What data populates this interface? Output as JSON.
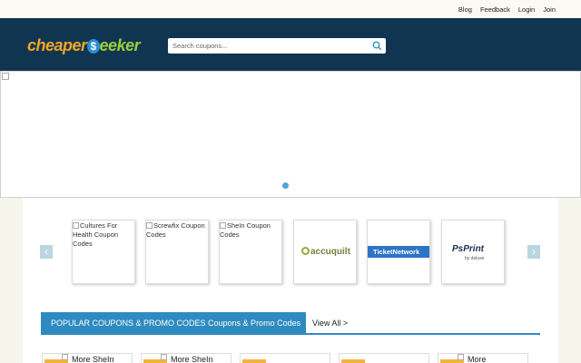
{
  "top_links": [
    "Blog",
    "Feedback",
    "Login",
    "Join"
  ],
  "logo": {
    "part1": "cheaper",
    "dollar": "$",
    "part2": "eeker"
  },
  "search": {
    "placeholder": "Search coupons..."
  },
  "stores": [
    {
      "label": "Cultures For Health Coupon Codes"
    },
    {
      "label": "Screwfix Coupon Codes"
    },
    {
      "label": "SheIn Coupon Codes"
    },
    {
      "logo": "accuquilt"
    },
    {
      "logo": "TicketNetwork"
    },
    {
      "logo": "PsPrint",
      "sub": "by deluxe"
    }
  ],
  "popular": {
    "title": "POPULAR COUPONS & PROMO CODES Coupons & Promo Codes",
    "view_all": "View All >"
  },
  "coupon_cards": [
    {
      "text": "More SheIn"
    },
    {
      "text": "More SheIn"
    },
    {
      "text": ""
    },
    {
      "text": ""
    },
    {
      "text": "More"
    }
  ],
  "colors": {
    "header": "#0f3550",
    "accent": "#2e8bc0",
    "tag": "#f4b43a",
    "page_bg": "#f6f5ec"
  }
}
